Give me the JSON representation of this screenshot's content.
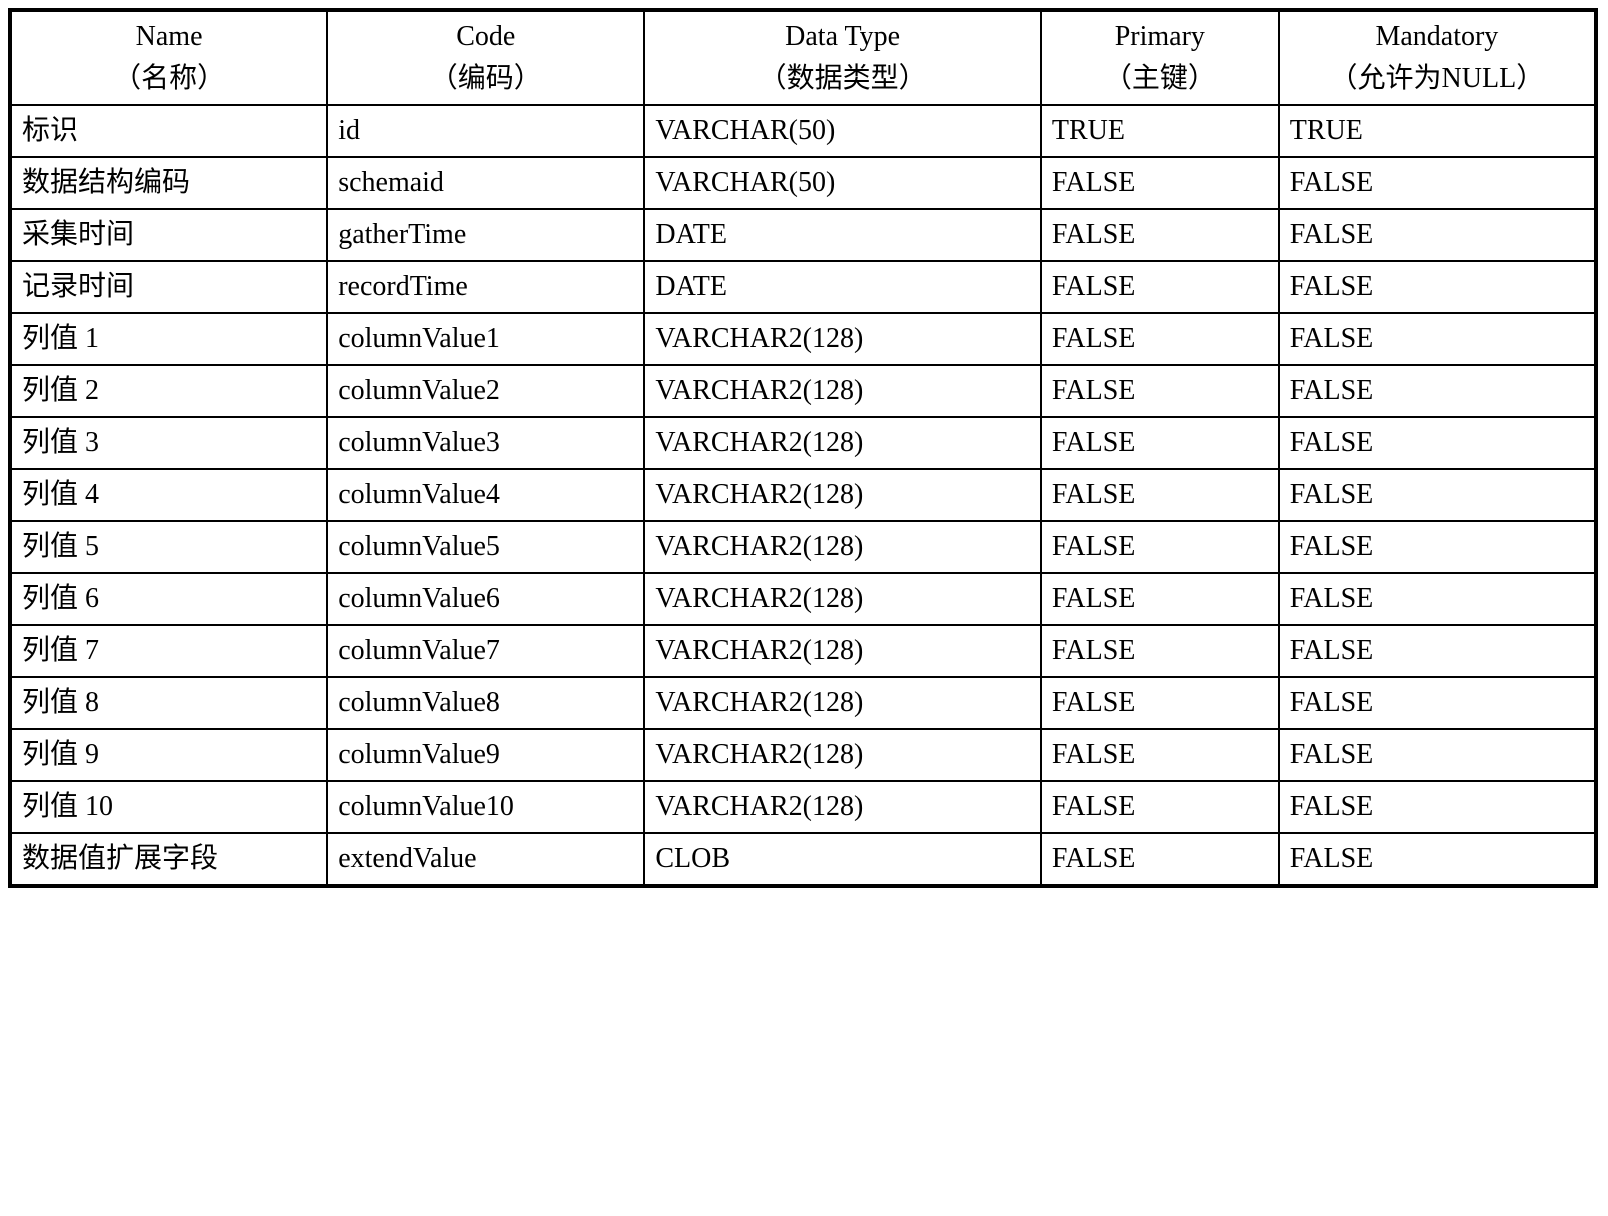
{
  "headers": {
    "name_en": "Name",
    "name_cn": "（名称）",
    "code_en": "Code",
    "code_cn": "（编码）",
    "type_en": "Data Type",
    "type_cn": "（数据类型）",
    "primary_en": "Primary",
    "primary_cn": "（主键）",
    "mandatory_en": "Mandatory",
    "mandatory_cn": "（允许为NULL）"
  },
  "rows": [
    {
      "name": "标识",
      "code": "id",
      "type": "VARCHAR(50)",
      "primary": "TRUE",
      "mandatory": "TRUE"
    },
    {
      "name": "数据结构编码",
      "code": "schemaid",
      "type": "VARCHAR(50)",
      "primary": "FALSE",
      "mandatory": "FALSE"
    },
    {
      "name": "采集时间",
      "code": "gatherTime",
      "type": "DATE",
      "primary": "FALSE",
      "mandatory": "FALSE"
    },
    {
      "name": "记录时间",
      "code": "recordTime",
      "type": "DATE",
      "primary": "FALSE",
      "mandatory": "FALSE"
    },
    {
      "name": "列值 1",
      "code": "columnValue1",
      "type": "VARCHAR2(128)",
      "primary": "FALSE",
      "mandatory": "FALSE"
    },
    {
      "name": "列值 2",
      "code": "columnValue2",
      "type": "VARCHAR2(128)",
      "primary": "FALSE",
      "mandatory": "FALSE"
    },
    {
      "name": "列值 3",
      "code": "columnValue3",
      "type": "VARCHAR2(128)",
      "primary": "FALSE",
      "mandatory": "FALSE"
    },
    {
      "name": "列值 4",
      "code": "columnValue4",
      "type": "VARCHAR2(128)",
      "primary": "FALSE",
      "mandatory": "FALSE"
    },
    {
      "name": "列值 5",
      "code": "columnValue5",
      "type": "VARCHAR2(128)",
      "primary": "FALSE",
      "mandatory": "FALSE"
    },
    {
      "name": "列值 6",
      "code": "columnValue6",
      "type": "VARCHAR2(128)",
      "primary": "FALSE",
      "mandatory": "FALSE"
    },
    {
      "name": "列值 7",
      "code": "columnValue7",
      "type": "VARCHAR2(128)",
      "primary": "FALSE",
      "mandatory": "FALSE"
    },
    {
      "name": "列值 8",
      "code": "columnValue8",
      "type": "VARCHAR2(128)",
      "primary": "FALSE",
      "mandatory": "FALSE"
    },
    {
      "name": "列值 9",
      "code": "columnValue9",
      "type": "VARCHAR2(128)",
      "primary": "FALSE",
      "mandatory": "FALSE"
    },
    {
      "name": "列值 10",
      "code": "columnValue10",
      "type": "VARCHAR2(128)",
      "primary": "FALSE",
      "mandatory": "FALSE"
    },
    {
      "name": "数据值扩展字段",
      "code": "extendValue",
      "type": "CLOB",
      "primary": "FALSE",
      "mandatory": "FALSE"
    }
  ]
}
